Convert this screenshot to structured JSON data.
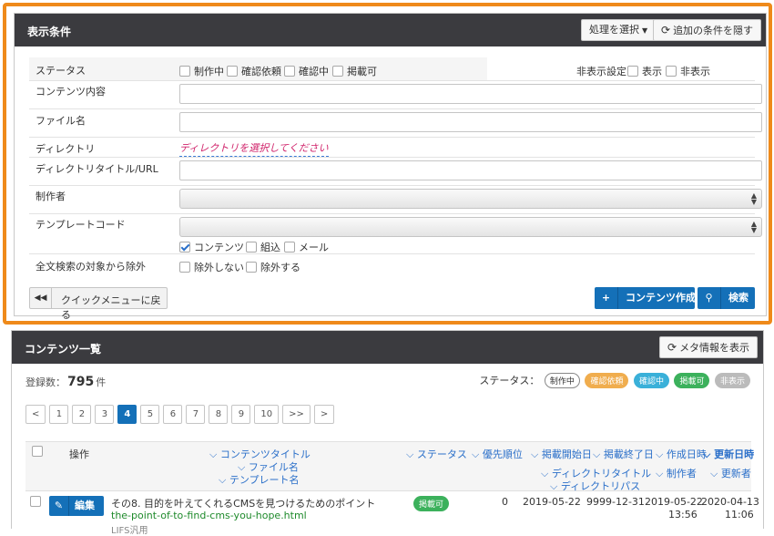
{
  "search": {
    "title": "表示条件",
    "process_btn": "処理を選択",
    "hide_btn": "追加の条件を隠す",
    "status_label": "ステータス",
    "status_opts": [
      "制作中",
      "確認依頼",
      "確認中",
      "掲載可"
    ],
    "hidden_label": "非表示設定",
    "hidden_opts": [
      "表示",
      "非表示"
    ],
    "content_label": "コンテンツ内容",
    "file_label": "ファイル名",
    "dir_label": "ディレクトリ",
    "dir_link": "ディレクトリを選択してください",
    "dirtitle_label": "ディレクトリタイトル/URL",
    "author_label": "制作者",
    "template_label": "テンプレートコード",
    "template_opts": [
      "コンテンツ",
      "組込",
      "メール"
    ],
    "fulltext_label": "全文検索の対象から除外",
    "fulltext_opts": [
      "除外しない",
      "除外する"
    ],
    "back_btn": "クイックメニューに戻る",
    "create_btn": "コンテンツ作成",
    "search_btn": "検索"
  },
  "list": {
    "title": "コンテンツ一覧",
    "meta_btn": "メタ情報を表示",
    "count_label": "登録数：",
    "count_value": "795",
    "count_unit": "件",
    "status_label": "ステータス：",
    "status_pills": [
      "制作中",
      "確認依頼",
      "確認中",
      "掲載可",
      "非表示"
    ],
    "pages": [
      "<",
      "1",
      "2",
      "3",
      "4",
      "5",
      "6",
      "7",
      "8",
      "9",
      "10",
      ">>",
      ">"
    ],
    "active_page": "4",
    "headers": {
      "op": "操作",
      "title": "コンテンツタイトル",
      "file": "ファイル名",
      "template": "テンプレート名",
      "status": "ステータス",
      "priority": "優先順位",
      "pub_start": "掲載開始日",
      "pub_end": "掲載終了日",
      "created": "作成日時",
      "updated": "更新日時",
      "dir_title": "ディレクトリタイトル",
      "dir_path": "ディレクトリパス",
      "author": "制作者",
      "updater": "更新者"
    },
    "row": {
      "edit": "編集",
      "title": "その8. 目的を叶えてくれるCMSを見つけるためのポイント",
      "file": "the-point-of-to-find-cms-you-hope.html",
      "template": "LIFS汎用",
      "status": "掲載可",
      "priority": "0",
      "pub_start": "2019-05-22",
      "pub_end": "9999-12-31",
      "created_date": "2019-05-22",
      "created_time": "13:56",
      "updated_date": "2020-04-13",
      "updated_time": "11:06"
    }
  }
}
